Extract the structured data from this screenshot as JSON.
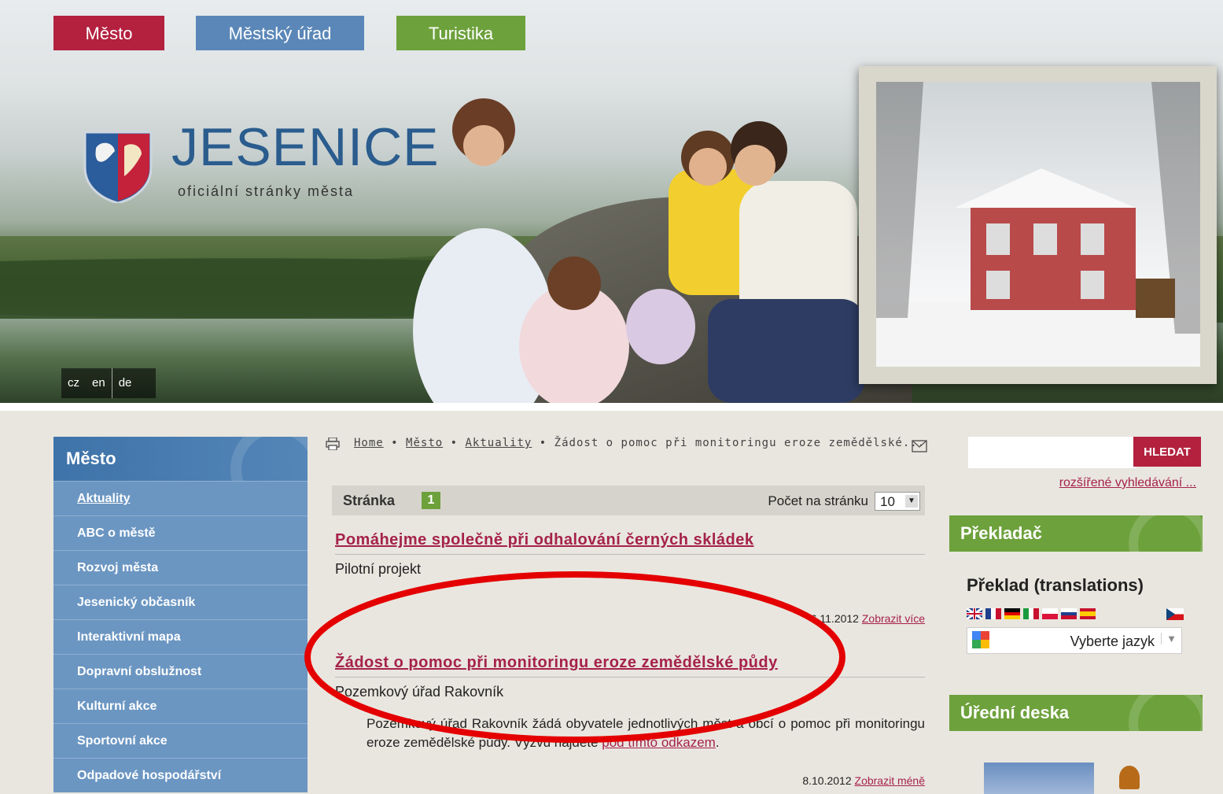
{
  "topnav": {
    "mesto": "Město",
    "urad": "Městský úřad",
    "turistika": "Turistika"
  },
  "site": {
    "title": "JESENICE",
    "subtitle": "oficiální stránky města"
  },
  "langs": [
    "cz",
    "en",
    "de"
  ],
  "sidebar": {
    "header": "Město",
    "items": [
      {
        "label": "Aktuality"
      },
      {
        "label": "ABC o městě"
      },
      {
        "label": "Rozvoj města"
      },
      {
        "label": "Jesenický občasník"
      },
      {
        "label": "Interaktivní mapa"
      },
      {
        "label": "Dopravní obslužnost"
      },
      {
        "label": "Kulturní akce"
      },
      {
        "label": "Sportovní akce"
      },
      {
        "label": "Odpadové hospodářství"
      }
    ]
  },
  "breadcrumb": {
    "home": "Home",
    "sep": "•",
    "mesto": "Město",
    "aktuality": "Aktuality",
    "current": "Žádost o pomoc při monitoringu eroze zemědělské..."
  },
  "pager": {
    "label": "Stránka",
    "current": "1",
    "per_page_label": "Počet na stránku",
    "per_page_value": "10"
  },
  "articles": [
    {
      "title": "Pomáhejme společně při odhalování černých skládek",
      "subtitle": "Pilotní projekt",
      "date": "6.11.2012",
      "link": "Zobrazit více"
    },
    {
      "title": "Žádost o pomoc při monitoringu eroze zemědělské půdy",
      "subtitle": "Pozemkový úřad Rakovník",
      "body_text": "Pozemkový úřad Rakovník žádá obyvatele jednotlivých měst a obcí o pomoc při monitoringu eroze zemědělské půdy. Výzvu najdete ",
      "body_link": "pod tímto odkazem",
      "body_end": ".",
      "date": "8.10.2012",
      "link": "Zobrazit méně"
    }
  ],
  "search": {
    "button": "HLEDAT",
    "advanced": "rozšířené vyhledávání ..."
  },
  "translator": {
    "header": "Překladač",
    "title": "Překlad (translations)",
    "select": "Vyberte jazyk",
    "select_arrow": "▼"
  },
  "board": {
    "header": "Úřední deska"
  },
  "colors": {
    "red": "#b3213f",
    "blue": "#5b87b8",
    "green": "#6da13c",
    "link": "#a5224a"
  }
}
